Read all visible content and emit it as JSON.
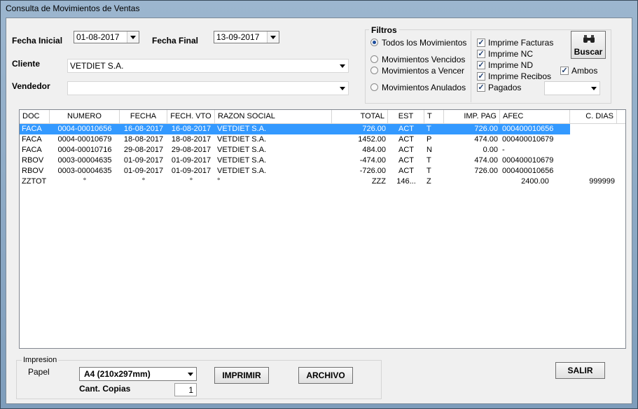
{
  "window": {
    "title": "Consulta de Movimientos de Ventas"
  },
  "filters": {
    "fecha_inicial_label": "Fecha Inicial",
    "fecha_inicial": "01-08-2017",
    "fecha_final_label": "Fecha Final",
    "fecha_final": "13-09-2017",
    "cliente_label": "Cliente",
    "cliente": "VETDIET S.A.",
    "vendedor_label": "Vendedor",
    "vendedor": ""
  },
  "filtros": {
    "title": "Filtros",
    "radios": [
      {
        "label": "Todos los Movimientos",
        "selected": true
      },
      {
        "label": "Movimientos Vencidos",
        "selected": false
      },
      {
        "label": "Movimientos a Vencer",
        "selected": false
      },
      {
        "label": "Movimientos Anulados",
        "selected": false
      }
    ],
    "checks": [
      {
        "label": "Imprime Facturas",
        "checked": true
      },
      {
        "label": "Imprime NC",
        "checked": true
      },
      {
        "label": "Imprime ND",
        "checked": true
      },
      {
        "label": "Imprime Recibos",
        "checked": true
      },
      {
        "label": "Pagados",
        "checked": true
      }
    ],
    "ambos_label": "Ambos",
    "ambos_checked": true,
    "pagados_select": "",
    "buscar_label": "Buscar",
    "buscar_icon": "binoculars-icon"
  },
  "table": {
    "columns": [
      "DOC",
      "NUMERO",
      "FECHA",
      "FECH. VTO",
      "RAZON SOCIAL",
      "TOTAL",
      "EST",
      "T",
      "IMP. PAG",
      "AFEC",
      "C. DIAS"
    ],
    "rows": [
      [
        "FACA",
        "0004-00010656",
        "16-08-2017",
        "16-08-2017",
        "VETDIET S.A.",
        "726.00",
        "ACT",
        "T",
        "726.00",
        "000400010656",
        ""
      ],
      [
        "FACA",
        "0004-00010679",
        "18-08-2017",
        "18-08-2017",
        "VETDIET S.A.",
        "1452.00",
        "ACT",
        "P",
        "474.00",
        "000400010679",
        ""
      ],
      [
        "FACA",
        "0004-00010716",
        "29-08-2017",
        "29-08-2017",
        "VETDIET S.A.",
        "484.00",
        "ACT",
        "N",
        "0.00",
        "-",
        ""
      ],
      [
        "RBOV",
        "0003-00004635",
        "01-09-2017",
        "01-09-2017",
        "VETDIET S.A.",
        "-474.00",
        "ACT",
        "T",
        "474.00",
        "000400010679",
        ""
      ],
      [
        "RBOV",
        "0003-00004635",
        "01-09-2017",
        "01-09-2017",
        "VETDIET S.A.",
        "-726.00",
        "ACT",
        "T",
        "726.00",
        "000400010656",
        ""
      ],
      [
        "ZZTOT",
        "°",
        "°",
        "°",
        "°",
        "ZZZ",
        "146...",
        "Z",
        "",
        "2400.00",
        "999999"
      ]
    ],
    "selected_row": 0
  },
  "impresion": {
    "title": "Impresion",
    "papel_label": "Papel",
    "papel": "A4 (210x297mm)",
    "copias_label": "Cant. Copias",
    "copias": "1",
    "imprimir_label": "IMPRIMIR",
    "archivo_label": "ARCHIVO"
  },
  "salir_label": "SALIR"
}
